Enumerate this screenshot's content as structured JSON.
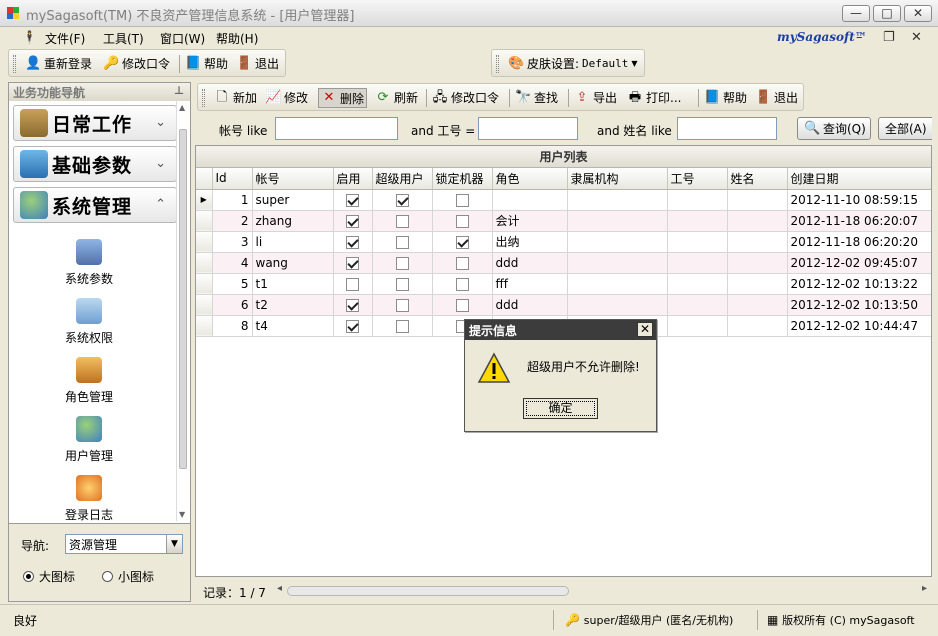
{
  "window": {
    "title": "mySagasoft(TM) 不良资产管理信息系统 - [用户管理器]",
    "btn_min": "—",
    "btn_max": "□",
    "btn_close": "✕"
  },
  "menu": {
    "items": [
      "文件(F)",
      "工具(T)",
      "窗口(W)",
      "帮助(H)"
    ],
    "brand": "mySagasoft™",
    "mdi_min": "–",
    "mdi_restore": "❐",
    "mdi_close": "✕"
  },
  "toolbar1": {
    "relogin": "重新登录",
    "change_pwd": "修改口令",
    "help": "帮助",
    "exit": "退出"
  },
  "skin": {
    "label": "皮肤设置:",
    "value": "Default"
  },
  "sidebar": {
    "header": "业务功能导航",
    "categories": [
      "日常工作",
      "基础参数",
      "系统管理"
    ],
    "items": [
      "系统参数",
      "系统权限",
      "角色管理",
      "用户管理",
      "登录日志"
    ],
    "nav_label": "导航:",
    "nav_value": "资源管理",
    "radio_large": "大图标",
    "radio_small": "小图标"
  },
  "toolbar2": {
    "new": "新加",
    "edit": "修改",
    "delete": "删除",
    "refresh": "刷新",
    "change_pwd": "修改口令",
    "find": "查找",
    "export": "导出",
    "print": "打印...",
    "help": "帮助",
    "exit": "退出"
  },
  "filter": {
    "account_label": "帐号 like",
    "empno_label": "and 工号 =",
    "name_label": "and 姓名 like",
    "query_btn": "查询(Q)",
    "all_btn": "全部(A)"
  },
  "grid": {
    "caption": "用户列表",
    "columns": [
      "Id",
      "帐号",
      "启用",
      "超级用户",
      "锁定机器",
      "角色",
      "隶属机构",
      "工号",
      "姓名",
      "创建日期"
    ],
    "rows": [
      {
        "id": "1",
        "account": "super",
        "enabled": true,
        "super": true,
        "locked": false,
        "role": "",
        "created": "2012-11-10 08:59:15"
      },
      {
        "id": "2",
        "account": "zhang",
        "enabled": true,
        "super": false,
        "locked": false,
        "role": "会计",
        "created": "2012-11-18 06:20:07"
      },
      {
        "id": "3",
        "account": "li",
        "enabled": true,
        "super": false,
        "locked": true,
        "role": "出纳",
        "created": "2012-11-18 06:20:20"
      },
      {
        "id": "4",
        "account": "wang",
        "enabled": true,
        "super": false,
        "locked": false,
        "role": "ddd",
        "created": "2012-12-02 09:45:07"
      },
      {
        "id": "5",
        "account": "t1",
        "enabled": false,
        "super": false,
        "locked": false,
        "role": "fff",
        "created": "2012-12-02 10:13:22"
      },
      {
        "id": "6",
        "account": "t2",
        "enabled": true,
        "super": false,
        "locked": false,
        "role": "ddd",
        "created": "2012-12-02 10:13:50"
      },
      {
        "id": "8",
        "account": "t4",
        "enabled": true,
        "super": false,
        "locked": false,
        "role": "",
        "created": "2012-12-02 10:44:47"
      }
    ],
    "record_info": "记录：1 / 7"
  },
  "dialog": {
    "title": "提示信息",
    "message": "超级用户不允许删除!",
    "ok": "确定",
    "close": "✕"
  },
  "status": {
    "left": "良好",
    "user": "super/超级用户 (匿名/无机构)",
    "copyright": "版权所有 (C) mySagasoft"
  }
}
